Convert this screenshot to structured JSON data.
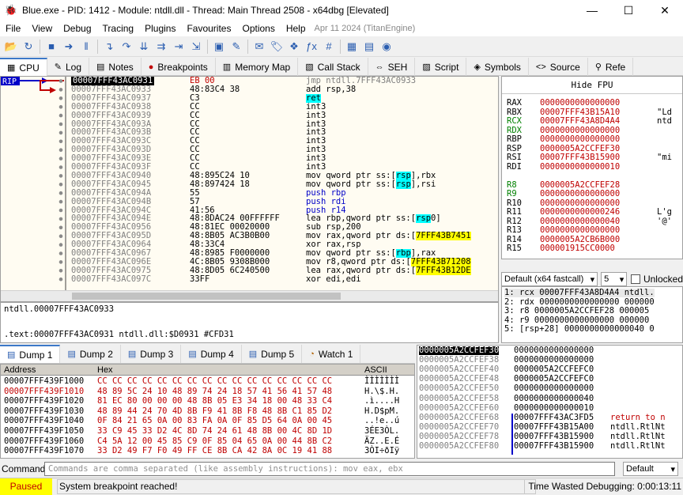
{
  "window": {
    "title": "Blue.exe - PID: 1412 - Module: ntdll.dll - Thread: Main Thread 2508 - x64dbg [Elevated]",
    "minimize": "—",
    "maximize": "☐",
    "close": "✕"
  },
  "menu": {
    "items": [
      "File",
      "View",
      "Debug",
      "Tracing",
      "Plugins",
      "Favourites",
      "Options",
      "Help"
    ],
    "stamp": "Apr 11 2024 (TitanEngine)"
  },
  "toolbar": {
    "icons": [
      "open-icon",
      "restart-icon",
      "stop-icon",
      "run-icon",
      "pause-icon",
      "step-into-icon",
      "step-over-icon",
      "trace-into-icon",
      "trace-over-icon",
      "execute-till-return-icon",
      "run-to-user-code-icon",
      "scylla-icon",
      "patch-icon",
      "comment-icon",
      "label-icon",
      "bookmark-icon",
      "function-icon",
      "hash-icon",
      "calculator-icon",
      "memory-icon",
      "sphere-icon"
    ],
    "glyphs": [
      "📂",
      "↻",
      "■",
      "➜",
      "‖",
      "↴",
      "↷",
      "⇊",
      "⇉",
      "⇥",
      "⇲",
      "▣",
      "✎",
      "✉",
      "🏷",
      "❖",
      "ƒx",
      "#",
      "▦",
      "▤",
      "◉"
    ]
  },
  "tabs": [
    {
      "label": "CPU",
      "icon": "▦",
      "active": true
    },
    {
      "label": "Log",
      "icon": "✎"
    },
    {
      "label": "Notes",
      "icon": "▤"
    },
    {
      "label": "Breakpoints",
      "icon": "●"
    },
    {
      "label": "Memory Map",
      "icon": "▥"
    },
    {
      "label": "Call Stack",
      "icon": "▧"
    },
    {
      "label": "SEH",
      "icon": "⇔"
    },
    {
      "label": "Script",
      "icon": "▨"
    },
    {
      "label": "Symbols",
      "icon": "◈"
    },
    {
      "label": "Source",
      "icon": "<>"
    },
    {
      "label": "Refe",
      "icon": "⚲"
    }
  ],
  "gutter": {
    "rip_label": "RIP"
  },
  "disasm": [
    {
      "addr": "00007FFF43AC0931",
      "bytes": "EB 00",
      "instr": "jmp ntdll.7FFF43AC0933",
      "selected": true,
      "style": "gray"
    },
    {
      "addr": "00007FFF43AC0933",
      "bytes": "48:83C4 38",
      "instr": "add rsp,38"
    },
    {
      "addr": "00007FFF43AC0937",
      "bytes": "C3",
      "instr": "ret",
      "style": "cyan"
    },
    {
      "addr": "00007FFF43AC0938",
      "bytes": "CC",
      "instr": "int3"
    },
    {
      "addr": "00007FFF43AC0939",
      "bytes": "CC",
      "instr": "int3"
    },
    {
      "addr": "00007FFF43AC093A",
      "bytes": "CC",
      "instr": "int3"
    },
    {
      "addr": "00007FFF43AC093B",
      "bytes": "CC",
      "instr": "int3"
    },
    {
      "addr": "00007FFF43AC093C",
      "bytes": "CC",
      "instr": "int3"
    },
    {
      "addr": "00007FFF43AC093D",
      "bytes": "CC",
      "instr": "int3"
    },
    {
      "addr": "00007FFF43AC093E",
      "bytes": "CC",
      "instr": "int3"
    },
    {
      "addr": "00007FFF43AC093F",
      "bytes": "CC",
      "instr": "int3"
    },
    {
      "addr": "00007FFF43AC0940",
      "bytes": "48:895C24 10",
      "instr": "mov qword ptr ss:[rsp+10],rbx"
    },
    {
      "addr": "00007FFF43AC0945",
      "bytes": "48:897424 18",
      "instr": "mov qword ptr ss:[rsp+18],rsi"
    },
    {
      "addr": "00007FFF43AC094A",
      "bytes": "55",
      "instr": "push rbp",
      "style": "blue"
    },
    {
      "addr": "00007FFF43AC094B",
      "bytes": "57",
      "instr": "push rdi",
      "style": "blue"
    },
    {
      "addr": "00007FFF43AC094C",
      "bytes": "41:56",
      "instr": "push r14",
      "style": "blue"
    },
    {
      "addr": "00007FFF43AC094E",
      "bytes": "48:8DAC24 00FFFFFF",
      "instr": "lea rbp,qword ptr ss:[rsp-100]"
    },
    {
      "addr": "00007FFF43AC0956",
      "bytes": "48:81EC 00020000",
      "instr": "sub rsp,200"
    },
    {
      "addr": "00007FFF43AC095D",
      "bytes": "48:8B05 AC3B0B00",
      "instr": "mov rax,qword ptr ds:[7FFF43B7451"
    },
    {
      "addr": "00007FFF43AC0964",
      "bytes": "48:33C4",
      "instr": "xor rax,rsp"
    },
    {
      "addr": "00007FFF43AC0967",
      "bytes": "48:8985 F0000000",
      "instr": "mov qword ptr ss:[rbp+F0],rax"
    },
    {
      "addr": "00007FFF43AC096E",
      "bytes": "4C:8B05 9308B000",
      "instr": "mov r8,qword ptr ds:[7FFF43B71208"
    },
    {
      "addr": "00007FFF43AC0975",
      "bytes": "48:8D05 6C240500",
      "instr": "lea rax,qword ptr ds:[7FFF43B12DE"
    },
    {
      "addr": "00007FFF43AC097C",
      "bytes": "33FF",
      "instr": "xor edi,edi"
    }
  ],
  "info": {
    "line1": "ntdll.00007FFF43AC0933",
    "line2": ".text:00007FFF43AC0931 ntdll.dll:$D0931 #CFD31"
  },
  "registers": {
    "hide_fpu": "Hide FPU",
    "rows": [
      {
        "name": "RAX",
        "value": "0000000000000000",
        "comment": ""
      },
      {
        "name": "RBX",
        "value": "00007FFF43B15A10",
        "comment": "\"Ld"
      },
      {
        "name": "RCX",
        "value": "00007FFF43A8D4A4",
        "comment": "ntd",
        "name_color": "#008000"
      },
      {
        "name": "RDX",
        "value": "0000000000000000",
        "comment": "",
        "name_color": "#008000"
      },
      {
        "name": "RBP",
        "value": "0000000000000000",
        "comment": ""
      },
      {
        "name": "RSP",
        "value": "0000005A2CCFEF30",
        "comment": ""
      },
      {
        "name": "RSI",
        "value": "00007FFF43B15900",
        "comment": "\"mi"
      },
      {
        "name": "RDI",
        "value": "0000000000000010",
        "comment": ""
      },
      {
        "name": "R8",
        "value": "0000005A2CCFEF28",
        "comment": "",
        "name_color": "#008000"
      },
      {
        "name": "R9",
        "value": "0000000000000000",
        "comment": "",
        "name_color": "#008000"
      },
      {
        "name": "R10",
        "value": "0000000000000000",
        "comment": ""
      },
      {
        "name": "R11",
        "value": "0000000000000246",
        "comment": "L'g"
      },
      {
        "name": "R12",
        "value": "0000000000000040",
        "comment": "'@'"
      },
      {
        "name": "R13",
        "value": "0000000000000000",
        "comment": ""
      },
      {
        "name": "R14",
        "value": "0000005A2CB6B000",
        "comment": ""
      },
      {
        "name": "R15",
        "value": "000001915CC0000",
        "comment": ""
      }
    ]
  },
  "callconv": {
    "selected": "Default (x64 fastcall)",
    "count": "5",
    "unlocked_label": "Unlocked"
  },
  "args": [
    "1: rcx 00007FFF43A8D4A4 ntdll.",
    "2: rdx 0000000000000000 000000",
    "3: r8 0000005A2CCFEF28 000005",
    "4: r9 0000000000000000 000000",
    "5: [rsp+28] 0000000000000040 0"
  ],
  "dump_tabs": [
    {
      "label": "Dump 1",
      "active": true
    },
    {
      "label": "Dump 2"
    },
    {
      "label": "Dump 3"
    },
    {
      "label": "Dump 4"
    },
    {
      "label": "Dump 5"
    },
    {
      "label": "Watch 1"
    }
  ],
  "dump_header": {
    "address": "Address",
    "hex": "Hex",
    "ascii": "ASCII"
  },
  "dump": [
    {
      "addr": "00007FFF439F1000",
      "hex": "CC CC CC CC CC CC CC CC CC CC CC CC CC CC CC CC",
      "ascii": "ÌÌÌÌÌÌÌ"
    },
    {
      "addr": "00007FFF439F1010",
      "hex": "48 89 5C 24 10 48 89 74 24 18 57 41 56 41 57 48",
      "ascii": "H.\\$.H.",
      "red": true
    },
    {
      "addr": "00007FFF439F1020",
      "hex": "81 EC 80 00 00 00 48 8B 05 E3 34 18 00 48 33 C4",
      "ascii": ".ì....H"
    },
    {
      "addr": "00007FFF439F1030",
      "hex": "48 89 44 24 70 4D 8B F9 41 8B F8 48 8B C1 85 D2",
      "ascii": "H.D$pM."
    },
    {
      "addr": "00007FFF439F1040",
      "hex": "0F 84 21 65 0A 00 83 FA 0A 0F 85 D5 64 0A 00 45",
      "ascii": "..!e..ú"
    },
    {
      "addr": "00007FFF439F1050",
      "hex": "33 C9 45 33 D2 4C 8D 74 24 61 48 8B 00 4C 8D 1D",
      "ascii": "3ÉE3ÒL."
    },
    {
      "addr": "00007FFF439F1060",
      "hex": "C4 5A 12 00 45 85 C9 0F 85 04 65 0A 00 44 8B C2",
      "ascii": "ÄZ..E.É"
    },
    {
      "addr": "00007FFF439F1070",
      "hex": "33 D2 49 F7 F0 49 FF CE 8B CA 42 8A 0C 19 41 88",
      "ascii": "3ÒI÷ðIÿ"
    }
  ],
  "stack": [
    {
      "addr": "0000005A2CCFEF30",
      "value": "0000000000000000",
      "comment": "",
      "selected": true
    },
    {
      "addr": "0000005A2CCFEF38",
      "value": "0000000000000000",
      "comment": ""
    },
    {
      "addr": "0000005A2CCFEF40",
      "value": "0000005A2CCFEFC0",
      "comment": ""
    },
    {
      "addr": "0000005A2CCFEF48",
      "value": "0000005A2CCFEFC0",
      "comment": ""
    },
    {
      "addr": "0000005A2CCFEF50",
      "value": "0000000000000000",
      "comment": ""
    },
    {
      "addr": "0000005A2CCFEF58",
      "value": "0000000000000040",
      "comment": ""
    },
    {
      "addr": "0000005A2CCFEF60",
      "value": "0000000000000010",
      "comment": ""
    },
    {
      "addr": "0000005A2CCFEF68",
      "value": "00007FFF43AC3FD5",
      "comment": "return to n",
      "red": true
    },
    {
      "addr": "0000005A2CCFEF70",
      "value": "00007FFF43B15A00",
      "comment": "ntdll.RtlNt"
    },
    {
      "addr": "0000005A2CCFEF78",
      "value": "00007FFF43B15900",
      "comment": "ntdll.RtlNt"
    },
    {
      "addr": "0000005A2CCFEF80",
      "value": "00007FFF43B15900",
      "comment": "ntdll.RtlNt"
    }
  ],
  "command": {
    "label": "Command:",
    "placeholder": "Commands are comma separated (like assembly instructions): mov eax, ebx",
    "mode": "Default"
  },
  "status": {
    "state": "Paused",
    "message": "System breakpoint reached!",
    "time_wasted": "Time Wasted Debugging: 0:00:13:11"
  }
}
